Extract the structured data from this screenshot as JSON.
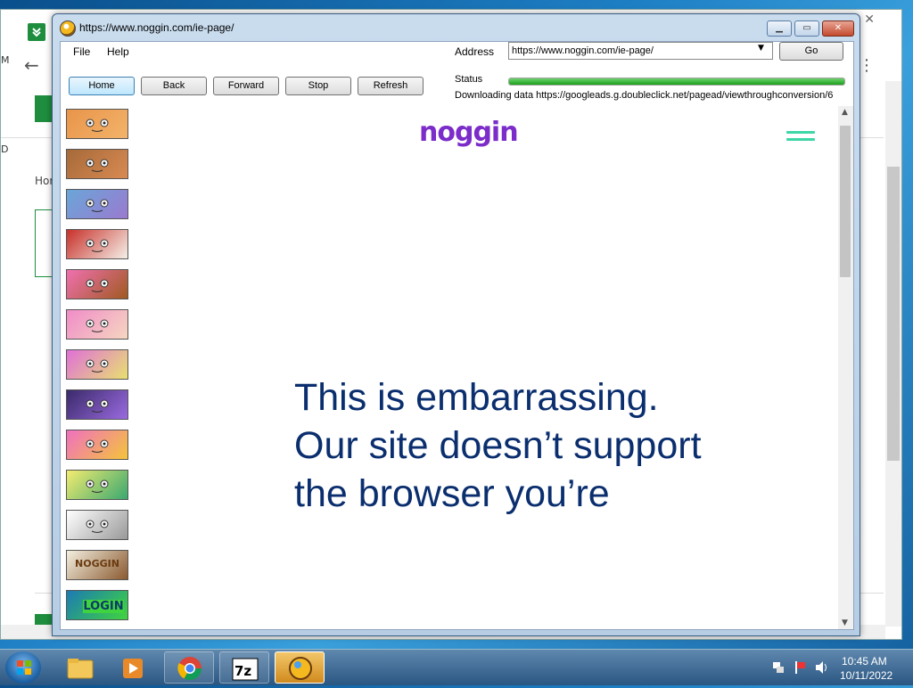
{
  "app": {
    "title": "https://www.noggin.com/ie-page/",
    "window_buttons": {
      "minimize": "▭",
      "maximize": "▭",
      "close": "✕"
    }
  },
  "menu": {
    "file": "File",
    "help": "Help"
  },
  "address": {
    "label": "Address",
    "value": "https://www.noggin.com/ie-page/",
    "go": "Go"
  },
  "toolbar": {
    "home": "Home",
    "back": "Back",
    "forward": "Forward",
    "stop": "Stop",
    "refresh": "Refresh"
  },
  "status": {
    "label": "Status",
    "progress": 1.0,
    "text": "Downloading data https://googleads.g.doubleclick.net/pagead/viewthroughconversion/6"
  },
  "sidebar": {
    "items": [
      {
        "name": "show-1",
        "colors": [
          "#e8954a",
          "#f3b36a"
        ]
      },
      {
        "name": "show-2",
        "colors": [
          "#a66a3a",
          "#d98a52"
        ]
      },
      {
        "name": "show-3",
        "colors": [
          "#6aa6d8",
          "#9a7ad0"
        ]
      },
      {
        "name": "show-4",
        "colors": [
          "#c8302a",
          "#f4f0e8"
        ]
      },
      {
        "name": "show-5",
        "colors": [
          "#f070b0",
          "#a05a20"
        ]
      },
      {
        "name": "show-6",
        "colors": [
          "#f08cc8",
          "#f6d6c0"
        ]
      },
      {
        "name": "show-7",
        "colors": [
          "#e070d8",
          "#e8e070"
        ]
      },
      {
        "name": "show-8",
        "colors": [
          "#3a2a6a",
          "#9a6ae0"
        ]
      },
      {
        "name": "show-9",
        "colors": [
          "#f070c0",
          "#f4c43a"
        ]
      },
      {
        "name": "show-10",
        "colors": [
          "#f4ec70",
          "#3aa870"
        ]
      },
      {
        "name": "show-11",
        "colors": [
          "#ffffff",
          "#999999"
        ]
      },
      {
        "name": "noggin-logo",
        "colors": [
          "#f4efe0",
          "#8a5a30"
        ],
        "text": "NOGGIN"
      },
      {
        "name": "login",
        "colors": [
          "#1c7ab4",
          "#3fd43f"
        ],
        "text": "LOGIN"
      }
    ]
  },
  "page": {
    "logo": "noggin",
    "headline": "This is embarrassing. Our site doesn’t support the browser you’re",
    "brand_color": "#7b2cc9",
    "headline_color": "#0a2e6e",
    "menu_color": "#3dd6a4"
  },
  "taskbar": {
    "time": "10:45 AM",
    "date": "10/11/2022",
    "items": [
      "file-explorer",
      "media-player",
      "chrome",
      "7zip",
      "noggin-browser"
    ]
  },
  "background_window": {
    "breadcrumb": "Hom"
  }
}
